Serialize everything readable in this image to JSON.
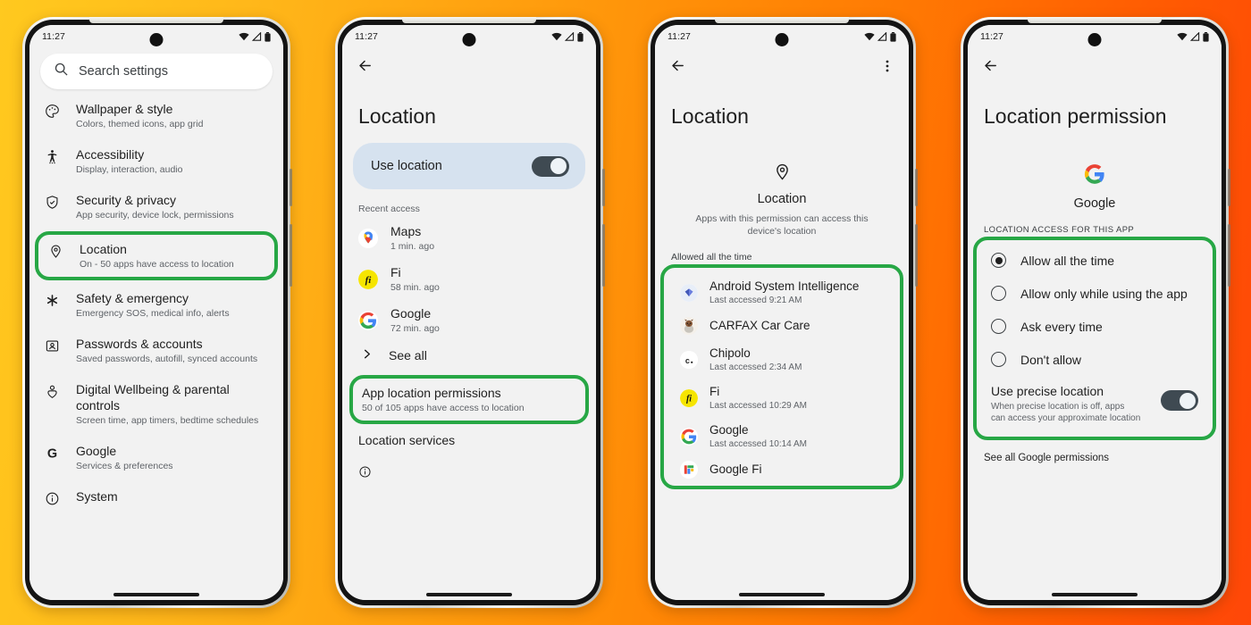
{
  "background": {
    "from": "#FFC91F",
    "to": "#FF4708"
  },
  "accent_highlight": "#27A745",
  "status_bar": {
    "time": "11:27",
    "icons": [
      "wifi-icon",
      "signal-icon",
      "battery-icon"
    ]
  },
  "screens": [
    {
      "id": "settings-home",
      "search": {
        "placeholder": "Search settings",
        "icon": "search-icon"
      },
      "items": [
        {
          "icon": "palette-icon",
          "title": "Wallpaper & style",
          "subtitle": "Colors, themed icons, app grid",
          "highlighted": false
        },
        {
          "icon": "accessibility-icon",
          "title": "Accessibility",
          "subtitle": "Display, interaction, audio",
          "highlighted": false
        },
        {
          "icon": "shield-check-icon",
          "title": "Security & privacy",
          "subtitle": "App security, device lock, permissions",
          "highlighted": false
        },
        {
          "icon": "location-pin-icon",
          "title": "Location",
          "subtitle": "On - 50 apps have access to location",
          "highlighted": true
        },
        {
          "icon": "asterisk-icon",
          "title": "Safety & emergency",
          "subtitle": "Emergency SOS, medical info, alerts",
          "highlighted": false
        },
        {
          "icon": "passwords-icon",
          "title": "Passwords & accounts",
          "subtitle": "Saved passwords, autofill, synced accounts",
          "highlighted": false
        },
        {
          "icon": "wellbeing-icon",
          "title": "Digital Wellbeing & parental controls",
          "subtitle": "Screen time, app timers, bedtime schedules",
          "highlighted": false
        },
        {
          "icon": "google-g-icon",
          "title": "Google",
          "subtitle": "Services & preferences",
          "highlighted": false
        },
        {
          "icon": "info-circle-icon",
          "title": "System",
          "subtitle": "",
          "highlighted": false
        }
      ]
    },
    {
      "id": "location-settings",
      "back_icon": "back-arrow-icon",
      "title": "Location",
      "toggle": {
        "label": "Use location",
        "state": "on"
      },
      "recent_access_header": "Recent access",
      "recent": [
        {
          "icon": "maps-icon",
          "name": "Maps",
          "time": "1 min. ago"
        },
        {
          "icon": "fi-icon",
          "name": "Fi",
          "time": "58 min. ago"
        },
        {
          "icon": "google-g-icon",
          "name": "Google",
          "time": "72 min. ago"
        }
      ],
      "see_all": {
        "label": "See all",
        "icon": "chevron-right-icon"
      },
      "app_permissions": {
        "title": "App location permissions",
        "subtitle": "50 of 105 apps have access to location",
        "highlighted": true
      },
      "location_services": "Location services",
      "footer_icon": "info-circle-icon"
    },
    {
      "id": "location-permission-apps",
      "back_icon": "back-arrow-icon",
      "overflow_icon": "more-vertical-icon",
      "title": "Location",
      "hero": {
        "icon": "location-pin-icon",
        "name": "Location",
        "description": "Apps with this permission can access this device's location"
      },
      "section_header": "Allowed all the time",
      "apps": [
        {
          "icon": "android-system-intelligence-icon",
          "name": "Android System Intelligence",
          "time": "Last accessed 9:21 AM"
        },
        {
          "icon": "carfax-icon",
          "name": "CARFAX Car Care",
          "time": ""
        },
        {
          "icon": "chipolo-icon",
          "name": "Chipolo",
          "time": "Last accessed 2:34 AM"
        },
        {
          "icon": "fi-icon",
          "name": "Fi",
          "time": "Last accessed 10:29 AM"
        },
        {
          "icon": "google-g-icon",
          "name": "Google",
          "time": "Last accessed 10:14 AM"
        },
        {
          "icon": "google-fi-icon",
          "name": "Google Fi",
          "time": ""
        }
      ],
      "highlighted": true
    },
    {
      "id": "app-location-permission",
      "back_icon": "back-arrow-icon",
      "title": "Location permission",
      "hero": {
        "icon": "google-g-icon",
        "name": "Google"
      },
      "section_header": "LOCATION ACCESS FOR THIS APP",
      "options": [
        {
          "label": "Allow all the time",
          "selected": true
        },
        {
          "label": "Allow only while using the app",
          "selected": false
        },
        {
          "label": "Ask every time",
          "selected": false
        },
        {
          "label": "Don't allow",
          "selected": false
        }
      ],
      "precise": {
        "title": "Use precise location",
        "subtitle": "When precise location is off, apps can access your approximate location",
        "state": "on"
      },
      "footer_link": "See all Google permissions",
      "highlighted": true
    }
  ]
}
